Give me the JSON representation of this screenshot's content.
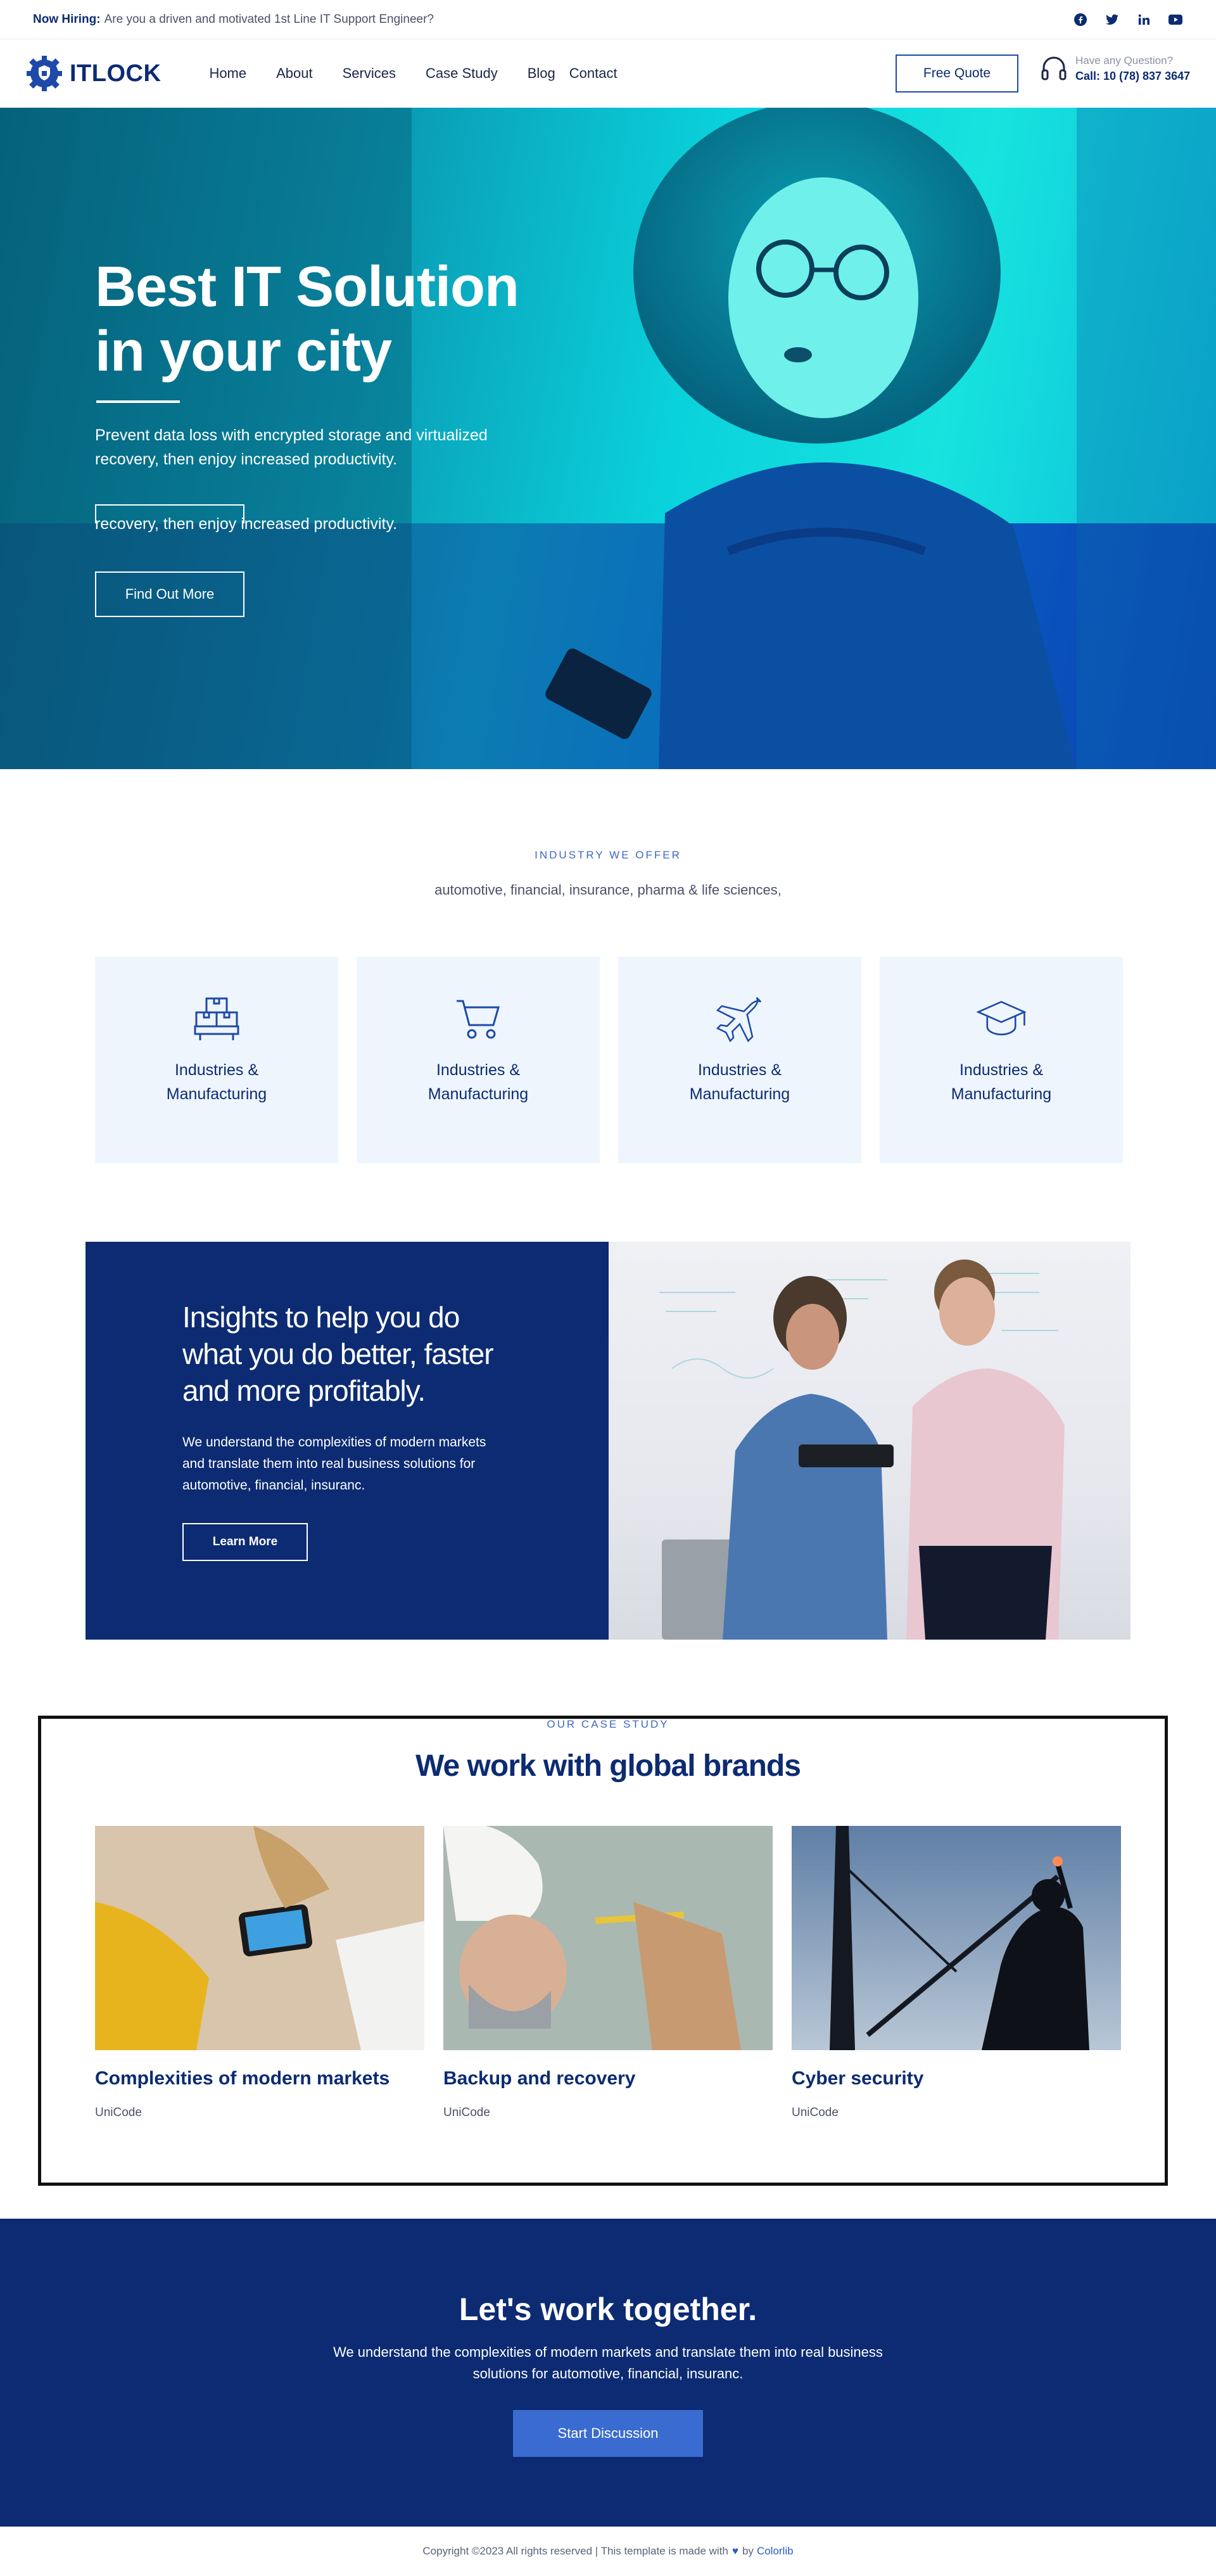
{
  "topbar": {
    "hiring_label": "Now Hiring:",
    "hiring_text": "Are you a driven and motivated 1st Line IT Support Engineer?",
    "socials": [
      "facebook-icon",
      "twitter-icon",
      "linkedin-icon",
      "youtube-icon"
    ]
  },
  "nav": {
    "logo": "ITLOCK",
    "links": [
      "Home",
      "About",
      "Services",
      "Case Study",
      "Blog",
      "Contact"
    ],
    "quote_button": "Free Quote",
    "question_label": "Have any Question?",
    "call_text": "Call: 10 (78) 837 3647"
  },
  "hero": {
    "title": "Best IT Solution in your city",
    "lead": "Prevent data loss with encrypted storage and virtualized recovery, then enjoy increased productivity.",
    "lead_ghost": "recovery, then enjoy increased productivity.",
    "button": "Find Out More"
  },
  "industry": {
    "eyebrow": "INDUSTRY WE OFFER",
    "subtitle": "automotive, financial, insurance, pharma & life sciences,",
    "cards": [
      {
        "icon": "boxes-icon",
        "title": "Industries & Manufacturing"
      },
      {
        "icon": "cart-icon",
        "title": "Industries & Manufacturing"
      },
      {
        "icon": "airplane-icon",
        "title": "Industries & Manufacturing"
      },
      {
        "icon": "graduation-cap-icon",
        "title": "Industries & Manufacturing"
      }
    ]
  },
  "insights": {
    "title": "Insights to help you do what you do better, faster and more profitably.",
    "text": "We understand the complexities of modern markets and translate them into real business solutions for automotive, financial, insuranc.",
    "button": "Learn More"
  },
  "case_study": {
    "eyebrow": "OUR CASE STUDY",
    "title": "We work with global brands",
    "items": [
      {
        "title": "Complexities of modern markets",
        "sub": "UniCode"
      },
      {
        "title": "Backup and recovery",
        "sub": "UniCode"
      },
      {
        "title": "Cyber security",
        "sub": "UniCode"
      }
    ]
  },
  "cta": {
    "title": "Let's work together.",
    "text": "We understand the complexities of modern markets and translate them into real business solutions for automotive, financial, insuranc.",
    "button": "Start Discussion"
  },
  "footer": {
    "text": "Copyright ©2023 All rights reserved | This template is made with",
    "by": "by",
    "link": "Colorlib"
  },
  "colors": {
    "brand_navy": "#0c2b72",
    "accent_blue": "#3a6bd0",
    "card_bg": "#eef5fd"
  }
}
